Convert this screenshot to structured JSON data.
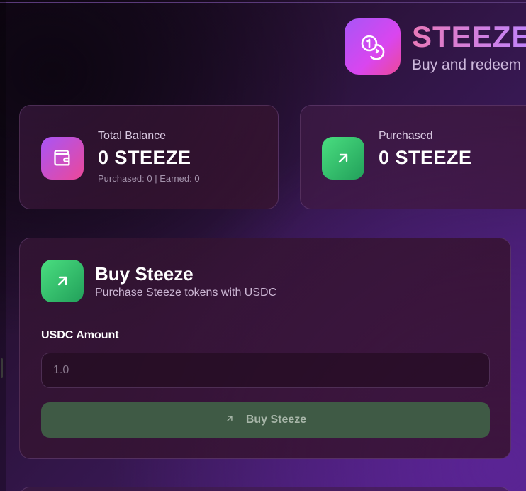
{
  "header": {
    "title": "STEEZE",
    "subtitle": "Buy and redeem",
    "logo_icon": "coins-icon"
  },
  "stats": [
    {
      "label": "Total Balance",
      "value": "0 STEEZE",
      "sub": "Purchased: 0 | Earned: 0",
      "icon": "wallet-icon"
    },
    {
      "label": "Purchased",
      "value": "0 STEEZE",
      "icon": "arrow-up-right-icon"
    }
  ],
  "buy": {
    "title": "Buy Steeze",
    "subtitle": "Purchase Steeze tokens with USDC",
    "amount_label": "USDC Amount",
    "amount_placeholder": "1.0",
    "amount_value": "",
    "button_label": "Buy Steeze",
    "icon": "arrow-up-right-icon"
  },
  "colors": {
    "accent_purple": "#a855f7",
    "accent_pink": "#ec4899",
    "accent_green": "#4ade80",
    "button_disabled": "#3f5a45"
  }
}
